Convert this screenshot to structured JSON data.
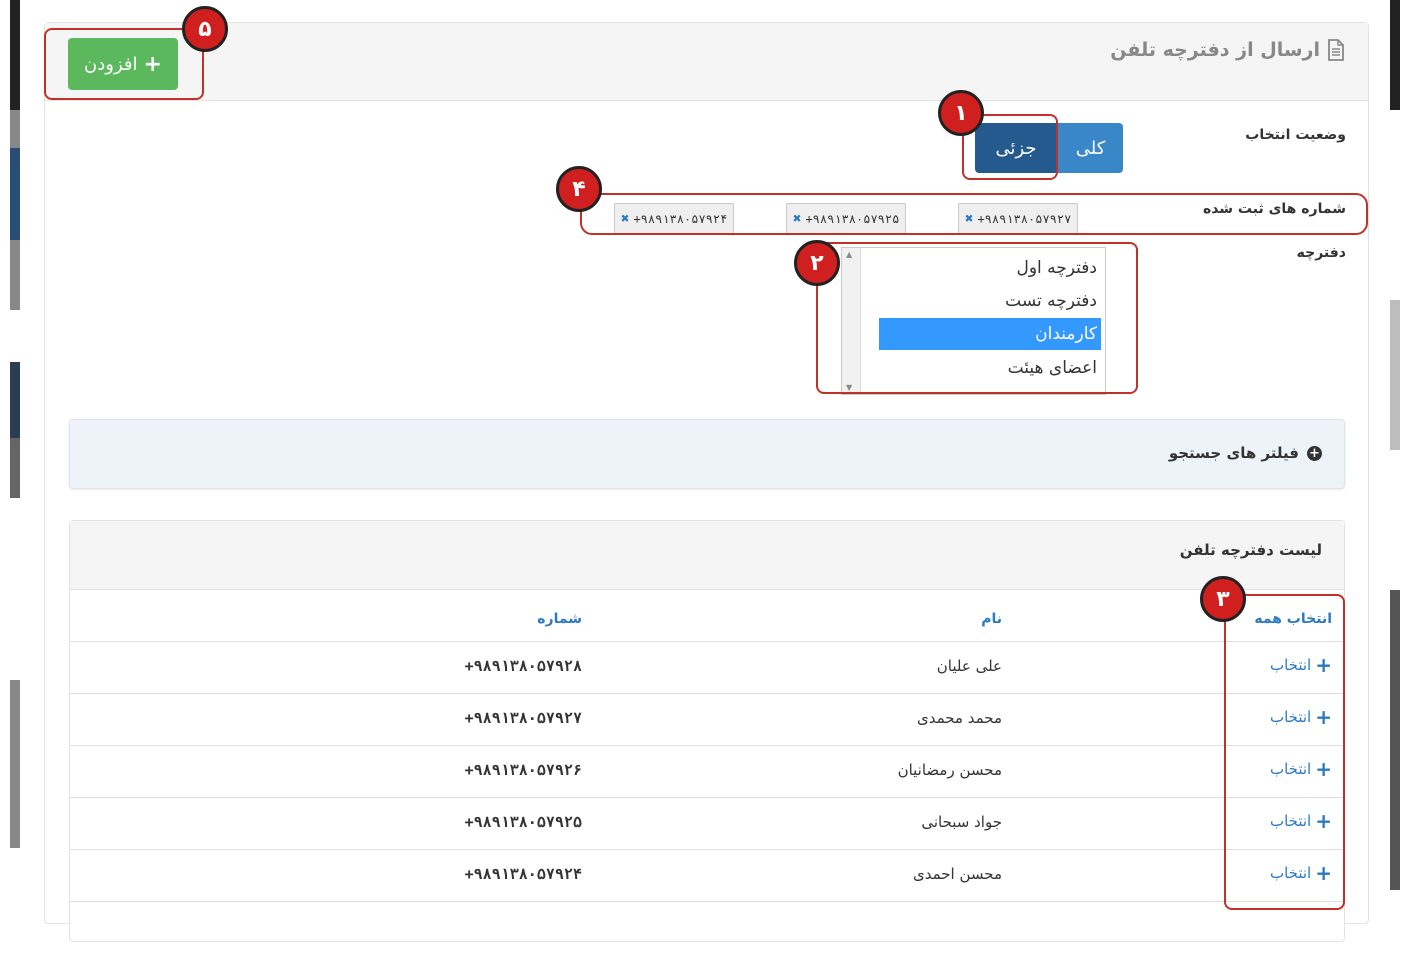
{
  "header": {
    "title": "ارسال از دفترچه تلفن",
    "title_icon": "file-text-icon",
    "add_button": "افزودن"
  },
  "selection_mode": {
    "label": "وضعیت انتخاب",
    "options": [
      "کلی",
      "جزئی"
    ],
    "active": "جزئی"
  },
  "registered": {
    "label": "شماره های ثبت شده",
    "tags": [
      "+۹۸۹۱۳۸۰۵۷۹۲۷",
      "+۹۸۹۱۳۸۰۵۷۹۲۵",
      "+۹۸۹۱۳۸۰۵۷۹۲۴"
    ]
  },
  "phonebook": {
    "label": "دفترچه",
    "options": [
      "دفترچه اول",
      "دفترچه تست",
      "کارمندان",
      "اعضای هیئت"
    ],
    "selected": "کارمندان"
  },
  "filters": {
    "label": "فیلتر های جستجو"
  },
  "list": {
    "title": "لیست دفترچه تلفن",
    "headers": {
      "select_all": "انتخاب همه",
      "name": "نام",
      "number": "شماره"
    },
    "select_label": "انتخاب",
    "rows": [
      {
        "name": "علی علیان",
        "number": "+۹۸۹۱۳۸۰۵۷۹۲۸"
      },
      {
        "name": "محمد محمدی",
        "number": "+۹۸۹۱۳۸۰۵۷۹۲۷"
      },
      {
        "name": "محسن رمضانیان",
        "number": "+۹۸۹۱۳۸۰۵۷۹۲۶"
      },
      {
        "name": "جواد سبحانی",
        "number": "+۹۸۹۱۳۸۰۵۷۹۲۵"
      },
      {
        "name": "محسن احمدی",
        "number": "+۹۸۹۱۳۸۰۵۷۹۲۴"
      }
    ]
  },
  "annotations": [
    "۱",
    "۲",
    "۳",
    "۴",
    "۵"
  ],
  "colors": {
    "green": "#5cb85c",
    "blue": "#3a87c8",
    "dark_blue": "#245a8d",
    "highlight": "#c0312b",
    "badge": "#d01f1f"
  }
}
